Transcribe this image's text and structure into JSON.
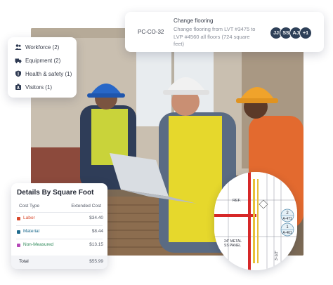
{
  "change_order": {
    "code": "PC-CO-32",
    "title": "Change flooring",
    "description": "Change flooring from LVT #3475 to LVP #4560 all floors (724 square feet)",
    "avatars": [
      "JJ",
      "SS",
      "AJ",
      "+1"
    ],
    "avatar_color": "#2e4058"
  },
  "categories": {
    "items": [
      {
        "label": "Workforce (2)",
        "icon": "people-icon"
      },
      {
        "label": "Equipment (2)",
        "icon": "truck-icon"
      },
      {
        "label": "Health & safety (1)",
        "icon": "shield-icon"
      },
      {
        "label": "Visitors (1)",
        "icon": "badge-icon"
      }
    ]
  },
  "details": {
    "title": "Details By Square Foot",
    "col_cost_type": "Cost Type",
    "col_extended_cost": "Extended Cost",
    "rows": [
      {
        "label": "Labor",
        "value": "$34.40",
        "color": "#d9482b"
      },
      {
        "label": "Material",
        "value": "$8.44",
        "color": "#1f6b8e"
      },
      {
        "label": "Non-Measured",
        "value": "$13.15",
        "color": "#b548b8"
      }
    ],
    "total_label": "Total",
    "total_value": "$55.99"
  },
  "blueprint": {
    "labels": [
      "REF.",
      "2",
      "A-471",
      "1",
      "A-461",
      "24\" METAL",
      "SS PANEL",
      "3'-1/2\""
    ]
  }
}
